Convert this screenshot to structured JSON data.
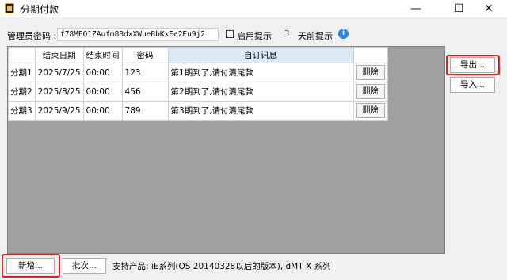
{
  "window": {
    "title": "分期付款",
    "minimize_glyph": "—",
    "maximize_glyph": "☐",
    "close_glyph": "✕"
  },
  "admin": {
    "password_label": "管理员密码 :",
    "password_value": "f78MEQ1ZAufm88dxXWueBbKxEe2Eu9j2",
    "reminder_checkbox_label": "启用提示",
    "reminder_days": "3",
    "reminder_suffix": "天前提示",
    "info_glyph": "i"
  },
  "table": {
    "columns": [
      "",
      "结束日期",
      "结束时间",
      "密码",
      "自订讯息",
      ""
    ],
    "rows": [
      {
        "header": "分期1",
        "end_date": "2025/7/25",
        "end_time": "00:00",
        "password": "123",
        "message": "第1期到了,请付清尾款",
        "action": "删除"
      },
      {
        "header": "分期2",
        "end_date": "2025/8/25",
        "end_time": "00:00",
        "password": "456",
        "message": "第2期到了,请付清尾款",
        "action": "删除"
      },
      {
        "header": "分期3",
        "end_date": "2025/9/25",
        "end_time": "00:00",
        "password": "789",
        "message": "第3期到了,请付清尾款",
        "action": "删除"
      }
    ]
  },
  "side": {
    "export_label": "导出...",
    "import_label": "导入..."
  },
  "footer": {
    "add_label": "新增...",
    "batch_label": "批次...",
    "support_text": "支持产品: iE系列(OS 20140328以后的版本), dMT X 系列"
  },
  "colors": {
    "highlight_frame": "#e02020",
    "info_blue": "#2f7fd9",
    "header_highlight": "#dceaf7"
  }
}
